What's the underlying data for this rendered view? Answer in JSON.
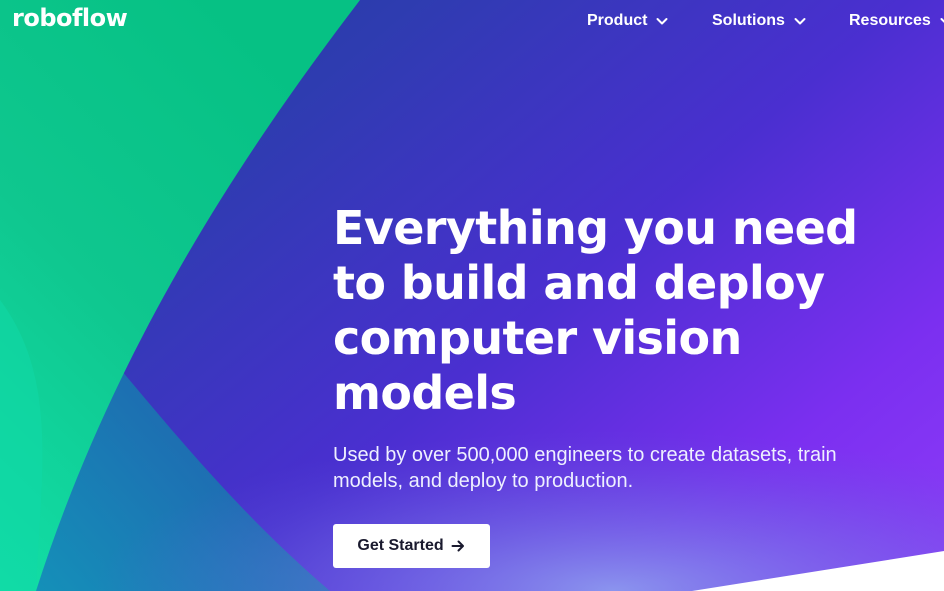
{
  "brand": {
    "logo_text": "roboflow"
  },
  "nav": {
    "items": [
      {
        "label": "Product"
      },
      {
        "label": "Solutions"
      },
      {
        "label": "Resources"
      }
    ]
  },
  "hero": {
    "headline_lines": [
      "Everything you need",
      "to build and deploy",
      "computer vision",
      "models"
    ],
    "subheadline_lines": [
      "Used by over 500,000 engineers to create datasets, train",
      "models, and deploy to production."
    ],
    "cta_label": "Get Started"
  },
  "icons": {
    "nav_dropdown": "chevron-down-icon",
    "cta": "arrow-right-icon"
  },
  "colors": {
    "green_accent": "#12d9a0",
    "purple_accent": "#8e3cf8",
    "blue_base": "#1f3f9e",
    "text_on_dark": "#ffffff",
    "cta_background": "#ffffff",
    "cta_text": "#1a1a2e"
  }
}
